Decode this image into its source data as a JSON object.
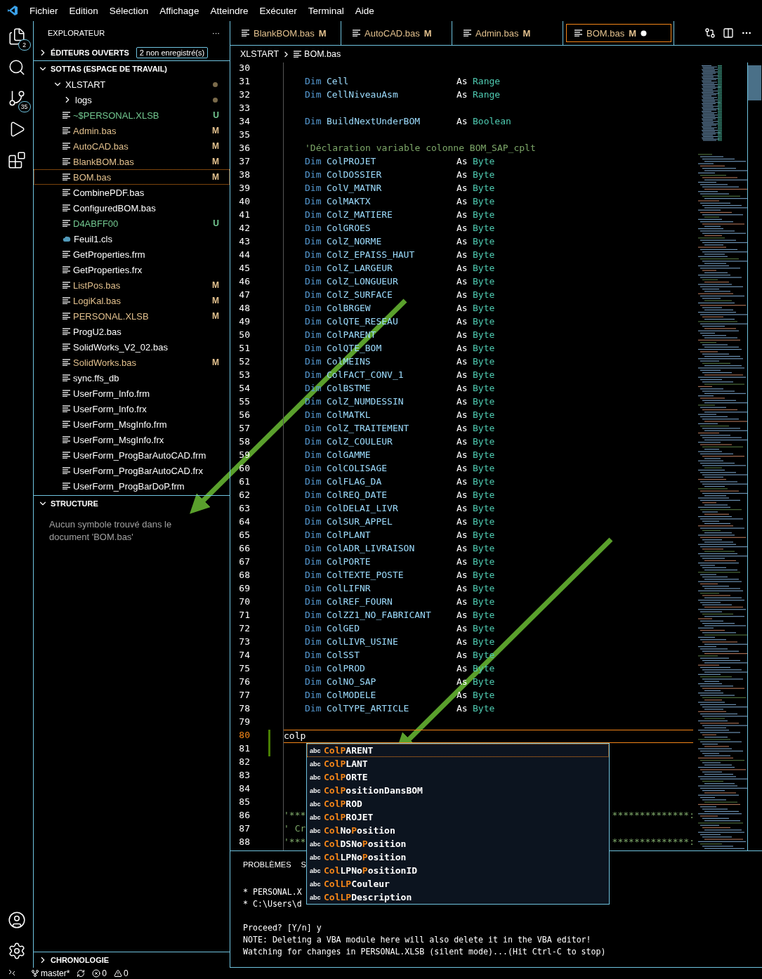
{
  "menu": [
    "Fichier",
    "Edition",
    "Sélection",
    "Affichage",
    "Atteindre",
    "Exécuter",
    "Terminal",
    "Aide"
  ],
  "activity": {
    "explorer_badge": "2",
    "scm_badge": "35"
  },
  "sidebar": {
    "title": "EXPLORATEUR",
    "more": "···",
    "open_editors": {
      "label": "ÉDITEURS OUVERTS",
      "badge": "2 non enregistré(s)",
      "expanded": false
    },
    "workspace": {
      "label": "SOTTAS (ESPACE DE TRAVAIL)",
      "expanded": true,
      "tree": [
        {
          "label": "XLSTART",
          "kind": "folder",
          "expanded": true,
          "dot": true,
          "color": "#ffffff",
          "selected": false,
          "children": [
            {
              "label": "logs",
              "kind": "folder",
              "expanded": false,
              "dot": true,
              "color": "#ffffff",
              "selected": false
            },
            {
              "label": "~$PERSONAL.XLSB",
              "kind": "file",
              "color": "#73c991",
              "decoration": "U",
              "selected": false
            },
            {
              "label": "Admin.bas",
              "kind": "file",
              "color": "#e2c08d",
              "decoration": "M",
              "selected": false
            },
            {
              "label": "AutoCAD.bas",
              "kind": "file",
              "color": "#e2c08d",
              "decoration": "M",
              "selected": false
            },
            {
              "label": "BlankBOM.bas",
              "kind": "file",
              "color": "#e2c08d",
              "decoration": "M",
              "selected": false
            },
            {
              "label": "BOM.bas",
              "kind": "file",
              "color": "#e2c08d",
              "decoration": "M",
              "selected": true
            },
            {
              "label": "CombinePDF.bas",
              "kind": "file",
              "color": "#ffffff",
              "selected": false
            },
            {
              "label": "ConfiguredBOM.bas",
              "kind": "file",
              "color": "#ffffff",
              "selected": false
            },
            {
              "label": "D4ABFF00",
              "kind": "file",
              "color": "#73c991",
              "decoration": "U",
              "selected": false
            },
            {
              "label": "Feuil1.cls",
              "kind": "cls",
              "color": "#ffffff",
              "selected": false
            },
            {
              "label": "GetProperties.frm",
              "kind": "file",
              "color": "#ffffff",
              "selected": false
            },
            {
              "label": "GetProperties.frx",
              "kind": "file",
              "color": "#ffffff",
              "selected": false
            },
            {
              "label": "ListPos.bas",
              "kind": "file",
              "color": "#e2c08d",
              "decoration": "M",
              "selected": false
            },
            {
              "label": "LogiKal.bas",
              "kind": "file",
              "color": "#e2c08d",
              "decoration": "M",
              "selected": false
            },
            {
              "label": "PERSONAL.XLSB",
              "kind": "file",
              "color": "#e2c08d",
              "decoration": "M",
              "selected": false
            },
            {
              "label": "ProgU2.bas",
              "kind": "file",
              "color": "#ffffff",
              "selected": false
            },
            {
              "label": "SolidWorks_V2_02.bas",
              "kind": "file",
              "color": "#ffffff",
              "selected": false
            },
            {
              "label": "SolidWorks.bas",
              "kind": "file",
              "color": "#e2c08d",
              "decoration": "M",
              "selected": false
            },
            {
              "label": "sync.ffs_db",
              "kind": "file",
              "color": "#ffffff",
              "selected": false
            },
            {
              "label": "UserForm_Info.frm",
              "kind": "file",
              "color": "#ffffff",
              "selected": false
            },
            {
              "label": "UserForm_Info.frx",
              "kind": "file",
              "color": "#ffffff",
              "selected": false
            },
            {
              "label": "UserForm_MsgInfo.frm",
              "kind": "file",
              "color": "#ffffff",
              "selected": false
            },
            {
              "label": "UserForm_MsgInfo.frx",
              "kind": "file",
              "color": "#ffffff",
              "selected": false
            },
            {
              "label": "UserForm_ProgBarAutoCAD.frm",
              "kind": "file",
              "color": "#ffffff",
              "selected": false
            },
            {
              "label": "UserForm_ProgBarAutoCAD.frx",
              "kind": "file",
              "color": "#ffffff",
              "selected": false
            },
            {
              "label": "UserForm_ProgBarDoP.frm",
              "kind": "file",
              "color": "#ffffff",
              "selected": false
            }
          ]
        }
      ]
    },
    "structure": {
      "label": "STRUCTURE",
      "expanded": true,
      "message": "Aucun symbole trouvé dans le document 'BOM.bas'"
    },
    "timeline": {
      "label": "CHRONOLOGIE",
      "expanded": false
    }
  },
  "tabs": [
    {
      "label": "BlankBOM.bas",
      "decoration": "M",
      "selected": false,
      "dirty": false
    },
    {
      "label": "AutoCAD.bas",
      "decoration": "M",
      "selected": false,
      "dirty": false
    },
    {
      "label": "Admin.bas",
      "decoration": "M",
      "selected": false,
      "dirty": false
    },
    {
      "label": "BOM.bas",
      "decoration": "M",
      "selected": true,
      "dirty": true
    }
  ],
  "breadcrumb": [
    "XLSTART",
    "BOM.bas"
  ],
  "code": [
    {
      "n": "30",
      "kind": "blank"
    },
    {
      "n": "31",
      "kind": "dim",
      "kw": "Dim",
      "name": "Cell",
      "as": "As",
      "type": "Range"
    },
    {
      "n": "32",
      "kind": "dim",
      "kw": "Dim",
      "name": "CellNiveauAsm",
      "as": "As",
      "type": "Range"
    },
    {
      "n": "33",
      "kind": "blank"
    },
    {
      "n": "34",
      "kind": "dim",
      "kw": "Dim",
      "name": "BuildNextUnderBOM",
      "as": "As",
      "type": "Boolean"
    },
    {
      "n": "35",
      "kind": "blank"
    },
    {
      "n": "36",
      "kind": "comment",
      "text": "'Déclaration variable colonne BOM_SAP_cplt"
    },
    {
      "n": "37",
      "kind": "dim",
      "kw": "Dim",
      "name": "ColPROJET",
      "as": "As",
      "type": "Byte"
    },
    {
      "n": "38",
      "kind": "dim",
      "kw": "Dim",
      "name": "ColDOSSIER",
      "as": "As",
      "type": "Byte"
    },
    {
      "n": "39",
      "kind": "dim",
      "kw": "Dim",
      "name": "ColV_MATNR",
      "as": "As",
      "type": "Byte"
    },
    {
      "n": "40",
      "kind": "dim",
      "kw": "Dim",
      "name": "ColMAKTX",
      "as": "As",
      "type": "Byte"
    },
    {
      "n": "41",
      "kind": "dim",
      "kw": "Dim",
      "name": "ColZ_MATIERE",
      "as": "As",
      "type": "Byte"
    },
    {
      "n": "42",
      "kind": "dim",
      "kw": "Dim",
      "name": "ColGROES",
      "as": "As",
      "type": "Byte"
    },
    {
      "n": "43",
      "kind": "dim",
      "kw": "Dim",
      "name": "ColZ_NORME",
      "as": "As",
      "type": "Byte"
    },
    {
      "n": "44",
      "kind": "dim",
      "kw": "Dim",
      "name": "ColZ_EPAISS_HAUT",
      "as": "As",
      "type": "Byte"
    },
    {
      "n": "45",
      "kind": "dim",
      "kw": "Dim",
      "name": "ColZ_LARGEUR",
      "as": "As",
      "type": "Byte"
    },
    {
      "n": "46",
      "kind": "dim",
      "kw": "Dim",
      "name": "ColZ_LONGUEUR",
      "as": "As",
      "type": "Byte"
    },
    {
      "n": "47",
      "kind": "dim",
      "kw": "Dim",
      "name": "ColZ_SURFACE",
      "as": "As",
      "type": "Byte"
    },
    {
      "n": "48",
      "kind": "dim",
      "kw": "Dim",
      "name": "ColBRGEW",
      "as": "As",
      "type": "Byte"
    },
    {
      "n": "49",
      "kind": "dim",
      "kw": "Dim",
      "name": "ColQTE_RESEAU",
      "as": "As",
      "type": "Byte"
    },
    {
      "n": "50",
      "kind": "dim",
      "kw": "Dim",
      "name": "ColPARENT",
      "as": "As",
      "type": "Byte"
    },
    {
      "n": "51",
      "kind": "dim",
      "kw": "Dim",
      "name": "ColQTE_BOM",
      "as": "As",
      "type": "Byte"
    },
    {
      "n": "52",
      "kind": "dim",
      "kw": "Dim",
      "name": "ColMEINS",
      "as": "As",
      "type": "Byte"
    },
    {
      "n": "53",
      "kind": "dim",
      "kw": "Dim",
      "name": "ColFACT_CONV_1",
      "as": "As",
      "type": "Byte"
    },
    {
      "n": "54",
      "kind": "dim",
      "kw": "Dim",
      "name": "ColBSTME",
      "as": "As",
      "type": "Byte"
    },
    {
      "n": "55",
      "kind": "dim",
      "kw": "Dim",
      "name": "ColZ_NUMDESSIN",
      "as": "As",
      "type": "Byte"
    },
    {
      "n": "56",
      "kind": "dim",
      "kw": "Dim",
      "name": "ColMATKL",
      "as": "As",
      "type": "Byte"
    },
    {
      "n": "57",
      "kind": "dim",
      "kw": "Dim",
      "name": "ColZ_TRAITEMENT",
      "as": "As",
      "type": "Byte"
    },
    {
      "n": "58",
      "kind": "dim",
      "kw": "Dim",
      "name": "ColZ_COULEUR",
      "as": "As",
      "type": "Byte"
    },
    {
      "n": "59",
      "kind": "dim",
      "kw": "Dim",
      "name": "ColGAMME",
      "as": "As",
      "type": "Byte"
    },
    {
      "n": "60",
      "kind": "dim",
      "kw": "Dim",
      "name": "ColCOLISAGE",
      "as": "As",
      "type": "Byte"
    },
    {
      "n": "61",
      "kind": "dim",
      "kw": "Dim",
      "name": "ColFLAG_DA",
      "as": "As",
      "type": "Byte"
    },
    {
      "n": "62",
      "kind": "dim",
      "kw": "Dim",
      "name": "ColREQ_DATE",
      "as": "As",
      "type": "Byte"
    },
    {
      "n": "63",
      "kind": "dim",
      "kw": "Dim",
      "name": "ColDELAI_LIVR",
      "as": "As",
      "type": "Byte"
    },
    {
      "n": "64",
      "kind": "dim",
      "kw": "Dim",
      "name": "ColSUR_APPEL",
      "as": "As",
      "type": "Byte"
    },
    {
      "n": "65",
      "kind": "dim",
      "kw": "Dim",
      "name": "ColPLANT",
      "as": "As",
      "type": "Byte"
    },
    {
      "n": "66",
      "kind": "dim",
      "kw": "Dim",
      "name": "ColADR_LIVRAISON",
      "as": "As",
      "type": "Byte"
    },
    {
      "n": "67",
      "kind": "dim",
      "kw": "Dim",
      "name": "ColPORTE",
      "as": "As",
      "type": "Byte"
    },
    {
      "n": "68",
      "kind": "dim",
      "kw": "Dim",
      "name": "ColTEXTE_POSTE",
      "as": "As",
      "type": "Byte"
    },
    {
      "n": "69",
      "kind": "dim",
      "kw": "Dim",
      "name": "ColLIFNR",
      "as": "As",
      "type": "Byte"
    },
    {
      "n": "70",
      "kind": "dim",
      "kw": "Dim",
      "name": "ColREF_FOURN",
      "as": "As",
      "type": "Byte"
    },
    {
      "n": "71",
      "kind": "dim",
      "kw": "Dim",
      "name": "ColZZ1_NO_FABRICANT",
      "as": "As",
      "type": "Byte"
    },
    {
      "n": "72",
      "kind": "dim",
      "kw": "Dim",
      "name": "ColGED",
      "as": "As",
      "type": "Byte"
    },
    {
      "n": "73",
      "kind": "dim",
      "kw": "Dim",
      "name": "ColLIVR_USINE",
      "as": "As",
      "type": "Byte"
    },
    {
      "n": "74",
      "kind": "dim",
      "kw": "Dim",
      "name": "ColSST",
      "as": "As",
      "type": "Byte"
    },
    {
      "n": "75",
      "kind": "dim",
      "kw": "Dim",
      "name": "ColPROD",
      "as": "As",
      "type": "Byte"
    },
    {
      "n": "76",
      "kind": "dim",
      "kw": "Dim",
      "name": "ColNO_SAP",
      "as": "As",
      "type": "Byte"
    },
    {
      "n": "77",
      "kind": "dim",
      "kw": "Dim",
      "name": "ColMODELE",
      "as": "As",
      "type": "Byte"
    },
    {
      "n": "78",
      "kind": "dim",
      "kw": "Dim",
      "name": "ColTYPE_ARTICLE",
      "as": "As",
      "type": "Byte"
    },
    {
      "n": "79",
      "kind": "blank"
    },
    {
      "n": "80",
      "kind": "typed",
      "text": "colp",
      "changed": true
    },
    {
      "n": "81",
      "kind": "blank",
      "changed": true
    },
    {
      "n": "82",
      "kind": "blank"
    },
    {
      "n": "83",
      "kind": "blank"
    },
    {
      "n": "84",
      "kind": "blank"
    },
    {
      "n": "85",
      "kind": "blank"
    },
    {
      "n": "86",
      "kind": "banner",
      "text": "'***",
      "tail": "**************:"
    },
    {
      "n": "87",
      "kind": "banner",
      "text": "' Cr"
    },
    {
      "n": "88",
      "kind": "banner",
      "text": "'***",
      "tail": "**************:"
    }
  ],
  "suggestions": [
    {
      "type": "abc",
      "selected": true,
      "parts": [
        {
          "t": "ColP",
          "hit": true
        },
        {
          "t": "ARENT",
          "hit": false
        }
      ]
    },
    {
      "type": "abc",
      "selected": false,
      "parts": [
        {
          "t": "ColP",
          "hit": true
        },
        {
          "t": "LANT",
          "hit": false
        }
      ]
    },
    {
      "type": "abc",
      "selected": false,
      "parts": [
        {
          "t": "ColP",
          "hit": true
        },
        {
          "t": "ORTE",
          "hit": false
        }
      ]
    },
    {
      "type": "abc",
      "selected": false,
      "parts": [
        {
          "t": "ColP",
          "hit": true
        },
        {
          "t": "ositionDansBOM",
          "hit": false
        }
      ]
    },
    {
      "type": "abc",
      "selected": false,
      "parts": [
        {
          "t": "ColP",
          "hit": true
        },
        {
          "t": "ROD",
          "hit": false
        }
      ]
    },
    {
      "type": "abc",
      "selected": false,
      "parts": [
        {
          "t": "ColP",
          "hit": true
        },
        {
          "t": "ROJET",
          "hit": false
        }
      ]
    },
    {
      "type": "abc",
      "selected": false,
      "parts": [
        {
          "t": "Col",
          "hit": true
        },
        {
          "t": "No",
          "hit": false
        },
        {
          "t": "P",
          "hit": true
        },
        {
          "t": "osition",
          "hit": false
        }
      ]
    },
    {
      "type": "abc",
      "selected": false,
      "parts": [
        {
          "t": "Col",
          "hit": true
        },
        {
          "t": "DSNo",
          "hit": false
        },
        {
          "t": "P",
          "hit": true
        },
        {
          "t": "osition",
          "hit": false
        }
      ]
    },
    {
      "type": "abc",
      "selected": false,
      "parts": [
        {
          "t": "Col",
          "hit": true
        },
        {
          "t": "LPNo",
          "hit": false
        },
        {
          "t": "P",
          "hit": true
        },
        {
          "t": "osition",
          "hit": false
        }
      ]
    },
    {
      "type": "abc",
      "selected": false,
      "parts": [
        {
          "t": "Col",
          "hit": true
        },
        {
          "t": "LPNo",
          "hit": false
        },
        {
          "t": "P",
          "hit": true
        },
        {
          "t": "ositionID",
          "hit": false
        }
      ]
    },
    {
      "type": "abc",
      "selected": false,
      "parts": [
        {
          "t": "ColLP",
          "hit": true
        },
        {
          "t": "Couleur",
          "hit": false
        }
      ]
    },
    {
      "type": "abc",
      "selected": false,
      "parts": [
        {
          "t": "ColLP",
          "hit": true
        },
        {
          "t": "Description",
          "hit": false
        }
      ]
    }
  ],
  "panel": {
    "tabs": [
      {
        "label": "PROBLÈMES",
        "selected": false
      },
      {
        "label": "S",
        "selected": false
      }
    ],
    "files": [
      "* PERSONAL.X",
      "* C:\\Users\\d"
    ],
    "messages": [
      "Proceed? [Y/n] y",
      "NOTE: Deleting a VBA module here will also delete it in the VBA editor!",
      "Watching for changes in PERSONAL.XLSB (silent mode)...(Hit Ctrl-C to stop)"
    ]
  },
  "status_bar": {
    "branch": "master*",
    "errors": "0",
    "warnings": "0"
  }
}
